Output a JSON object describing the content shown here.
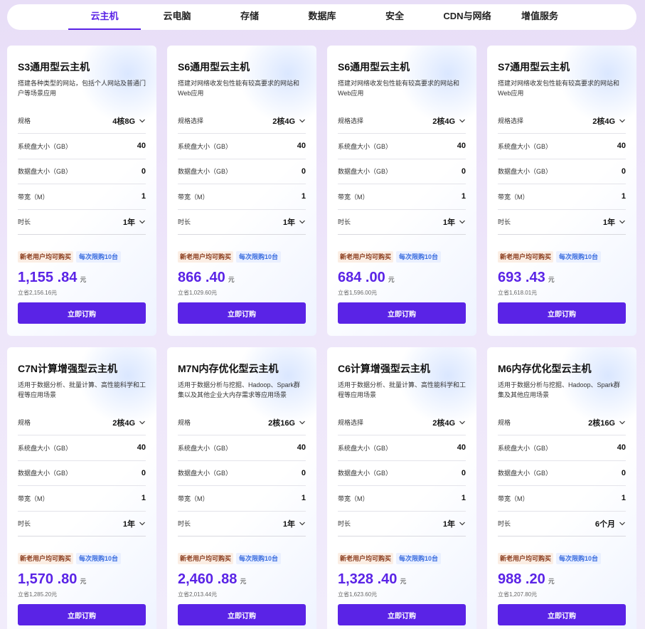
{
  "nav": {
    "tabs": [
      "云主机",
      "云电脑",
      "存储",
      "数据库",
      "安全",
      "CDN与网络",
      "增值服务"
    ],
    "active_index": 0
  },
  "cards": [
    {
      "title": "S3通用型云主机",
      "desc": "搭建各种类型的网站，包括个人网站及普通门户等场景应用",
      "spec_label": "规格",
      "spec_value": "4核8G",
      "sys_label": "系统盘大小（GB）",
      "sys_value": "40",
      "data_label": "数据盘大小（GB）",
      "data_value": "0",
      "bw_label": "带宽（M）",
      "bw_value": "1",
      "dur_label": "时长",
      "dur_value": "1年",
      "badge1": "新老用户均可购买",
      "badge2": "每次限购10台",
      "price": "1,155 .84",
      "unit": "元",
      "save": "立省2,156.16元",
      "buy": "立即订购"
    },
    {
      "title": "S6通用型云主机",
      "desc": "搭建对网络收发包性能有较高要求的网站和Web应用",
      "spec_label": "规格选择",
      "spec_value": "2核4G",
      "sys_label": "系统盘大小（GB）",
      "sys_value": "40",
      "data_label": "数据盘大小（GB）",
      "data_value": "0",
      "bw_label": "带宽（M）",
      "bw_value": "1",
      "dur_label": "时长",
      "dur_value": "1年",
      "badge1": "新老用户均可购买",
      "badge2": "每次限购10台",
      "price": "866 .40",
      "unit": "元",
      "save": "立省1,029.60元",
      "buy": "立即订购"
    },
    {
      "title": "S6通用型云主机",
      "desc": "搭建对网络收发包性能有较高要求的网站和Web应用",
      "spec_label": "规格选择",
      "spec_value": "2核4G",
      "sys_label": "系统盘大小（GB）",
      "sys_value": "40",
      "data_label": "数据盘大小（GB）",
      "data_value": "0",
      "bw_label": "带宽（M）",
      "bw_value": "1",
      "dur_label": "时长",
      "dur_value": "1年",
      "badge1": "新老用户均可购买",
      "badge2": "每次限购10台",
      "price": "684 .00",
      "unit": "元",
      "save": "立省1,596.00元",
      "buy": "立即订购"
    },
    {
      "title": "S7通用型云主机",
      "desc": "搭建对网络收发包性能有较高要求的网站和Web应用",
      "spec_label": "规格选择",
      "spec_value": "2核4G",
      "sys_label": "系统盘大小（GB）",
      "sys_value": "40",
      "data_label": "数据盘大小（GB）",
      "data_value": "0",
      "bw_label": "带宽（M）",
      "bw_value": "1",
      "dur_label": "时长",
      "dur_value": "1年",
      "badge1": "新老用户均可购买",
      "badge2": "每次限购10台",
      "price": "693 .43",
      "unit": "元",
      "save": "立省1,618.01元",
      "buy": "立即订购"
    },
    {
      "title": "C7N计算增强型云主机",
      "desc": "适用于数据分析、批量计算、高性能科学和工程等应用场景",
      "spec_label": "规格",
      "spec_value": "2核4G",
      "sys_label": "系统盘大小（GB）",
      "sys_value": "40",
      "data_label": "数据盘大小（GB）",
      "data_value": "0",
      "bw_label": "带宽（M）",
      "bw_value": "1",
      "dur_label": "时长",
      "dur_value": "1年",
      "badge1": "新老用户均可购买",
      "badge2": "每次限购10台",
      "price": "1,570 .80",
      "unit": "元",
      "save": "立省1,285.20元",
      "buy": "立即订购"
    },
    {
      "title": "M7N内存优化型云主机",
      "desc": "适用于数据分析与挖掘、Hadoop、Spark群集以及其他企业大内存需求等应用场景",
      "spec_label": "规格",
      "spec_value": "2核16G",
      "sys_label": "系统盘大小（GB）",
      "sys_value": "40",
      "data_label": "数据盘大小（GB）",
      "data_value": "0",
      "bw_label": "带宽（M）",
      "bw_value": "1",
      "dur_label": "时长",
      "dur_value": "1年",
      "badge1": "新老用户均可购买",
      "badge2": "每次限购10台",
      "price": "2,460 .88",
      "unit": "元",
      "save": "立省2,013.44元",
      "buy": "立即订购"
    },
    {
      "title": "C6计算增强型云主机",
      "desc": "适用于数据分析、批量计算、高性能科学和工程等应用场景",
      "spec_label": "规格选择",
      "spec_value": "2核4G",
      "sys_label": "系统盘大小（GB）",
      "sys_value": "40",
      "data_label": "数据盘大小（GB）",
      "data_value": "0",
      "bw_label": "带宽（M）",
      "bw_value": "1",
      "dur_label": "时长",
      "dur_value": "1年",
      "badge1": "新老用户均可购买",
      "badge2": "每次限购10台",
      "price": "1,328 .40",
      "unit": "元",
      "save": "立省1,623.60元",
      "buy": "立即订购"
    },
    {
      "title": "M6内存优化型云主机",
      "desc": "适用于数据分析与挖掘、Hadoop、Spark群集及其他应用场景",
      "spec_label": "规格",
      "spec_value": "2核16G",
      "sys_label": "系统盘大小（GB）",
      "sys_value": "40",
      "data_label": "数据盘大小（GB）",
      "data_value": "0",
      "bw_label": "带宽（M）",
      "bw_value": "1",
      "dur_label": "时长",
      "dur_value": "6个月",
      "badge1": "新老用户均可购买",
      "badge2": "每次限购10台",
      "price": "988 .20",
      "unit": "元",
      "save": "立省1,207.80元",
      "buy": "立即订购"
    }
  ]
}
